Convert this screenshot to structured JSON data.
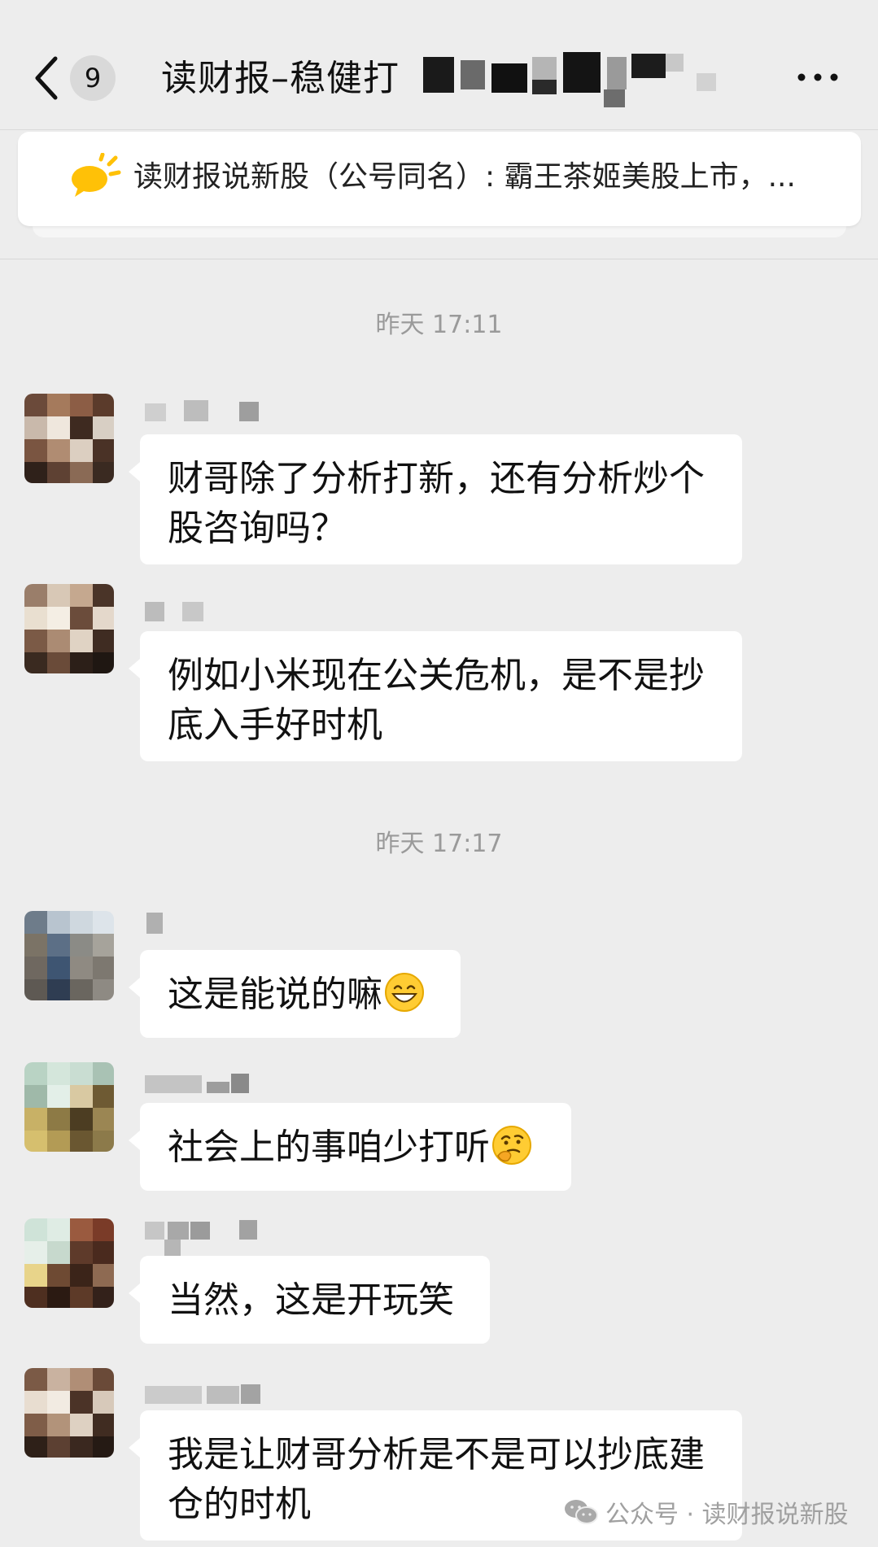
{
  "header": {
    "unread_count": "9",
    "title": "读财报–稳健打"
  },
  "pinned_notice": {
    "text": "读财报说新股（公号同名）: 霸王茶姬美股上市，..."
  },
  "colors": {
    "background": "#ededed",
    "bubble": "#ffffff",
    "notice_icon": "#ffc107",
    "timestamp_text": "#9a9a9a"
  },
  "messages": [
    {
      "type": "timestamp",
      "text": "昨天 17:11"
    },
    {
      "type": "message",
      "text": "财哥除了分析打新，还有分析炒个股咨询吗？"
    },
    {
      "type": "message",
      "text": "例如小米现在公关危机，是不是抄底入手好时机"
    },
    {
      "type": "timestamp",
      "text": "昨天 17:17"
    },
    {
      "type": "message",
      "text": "这是能说的嘛",
      "emoji": "grinning-face-emoji"
    },
    {
      "type": "message",
      "text": "社会上的事咱少打听",
      "emoji": "thinking-face-emoji"
    },
    {
      "type": "message",
      "text": "当然，这是开玩笑"
    },
    {
      "type": "message",
      "text": "我是让财哥分析是不是可以抄底建仓的时机"
    }
  ],
  "watermark": {
    "text": "公众号 · 读财报说新股"
  }
}
